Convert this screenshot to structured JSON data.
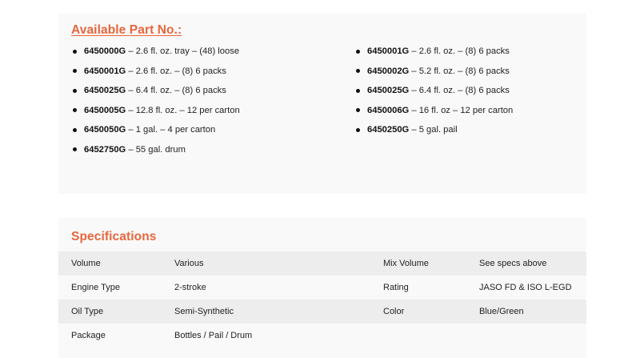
{
  "parts": {
    "title": "Available Part No.:",
    "left": [
      {
        "code": "6450000G",
        "desc": " – 2.6 fl. oz. tray – (48) loose"
      },
      {
        "code": "6450001G",
        "desc": " – 2.6 fl. oz. – (8) 6 packs"
      },
      {
        "code": "6450025G",
        "desc": " – 6.4 fl. oz. – (8) 6 packs"
      },
      {
        "code": "6450005G",
        "desc": " – 12.8 fl. oz. – 12 per carton"
      },
      {
        "code": "6450050G",
        "desc": " – 1 gal. – 4 per carton"
      },
      {
        "code": "6452750G",
        "desc": " – 55 gal. drum"
      }
    ],
    "right": [
      {
        "code": "6450001G",
        "desc": " – 2.6 fl. oz. – (8) 6 packs"
      },
      {
        "code": "6450002G",
        "desc": " – 5.2 fl. oz. – (8) 6 packs"
      },
      {
        "code": "6450025G",
        "desc": " – 6.4 fl. oz. – (8) 6 packs"
      },
      {
        "code": "6450006G",
        "desc": " – 16 fl. oz – 12 per carton"
      },
      {
        "code": "6450250G",
        "desc": " – 5 gal. pail"
      }
    ]
  },
  "specs": {
    "title": "Specifications",
    "rows": [
      {
        "label1": "Volume",
        "value1": "Various",
        "label2": "Mix Volume",
        "value2": "See specs above"
      },
      {
        "label1": "Engine Type",
        "value1": "2-stroke",
        "label2": "Rating",
        "value2": "JASO FD & ISO L-EGD"
      },
      {
        "label1": "Oil Type",
        "value1": "Semi-Synthetic",
        "label2": "Color",
        "value2": "Blue/Green"
      },
      {
        "label1": "Package",
        "value1": "Bottles / Pail / Drum",
        "label2": "",
        "value2": ""
      }
    ]
  },
  "colors": {
    "accent": "#e8663d",
    "panel_bg": "#f9f9f9",
    "row_shade": "#ededed"
  }
}
